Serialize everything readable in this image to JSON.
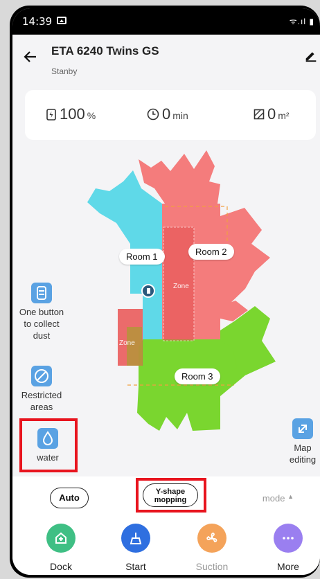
{
  "status_bar": {
    "time": "14:39",
    "signal": "ᯤ.ıl ▮"
  },
  "header": {
    "title": "ETA 6240 Twins GS",
    "subtitle": "Stanby"
  },
  "stats": {
    "battery_value": "100",
    "battery_unit": "%",
    "time_value": "0",
    "time_unit": "min",
    "area_value": "0",
    "area_unit": "m²"
  },
  "map": {
    "rooms": [
      "Room 1",
      "Room 2",
      "Room 3"
    ],
    "zone_label": "Zone"
  },
  "side_tools": {
    "collect_dust": "One button\nto collect\ndust",
    "restricted": "Restricted\nareas",
    "water": "water",
    "map_editing": "Map\nediting"
  },
  "modes": {
    "auto": "Auto",
    "y_shape": "Y-shape\nmopping",
    "mode": "mode"
  },
  "actions": {
    "dock": "Dock",
    "start": "Start",
    "suction": "Suction",
    "more": "More"
  },
  "colors": {
    "room1": "#5fd9e8",
    "room2": "#f47c7c",
    "room3": "#7ad62f",
    "dock": "#3fbf84",
    "start": "#2f6fe0",
    "suction": "#f4a35a",
    "more": "#9a7ff0",
    "highlight": "#e8141e"
  }
}
